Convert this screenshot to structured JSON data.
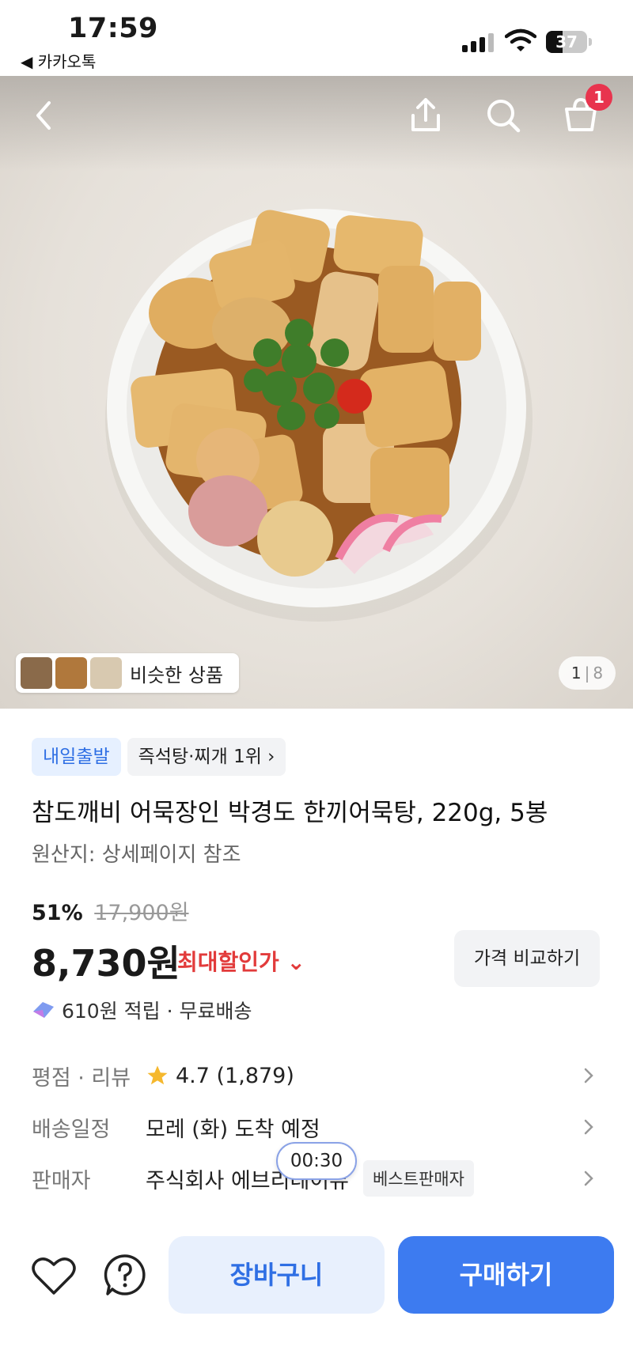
{
  "status_bar": {
    "time": "17:59",
    "back_app": "◀ 카카오톡",
    "battery": "37"
  },
  "header": {
    "cart_badge": "1",
    "icons": [
      "back-arrow-icon",
      "share-icon",
      "search-icon",
      "cart-icon"
    ]
  },
  "gallery": {
    "similar_label": "비슷한 상품",
    "page_current": "1",
    "page_sep": "|",
    "page_total": "8"
  },
  "product": {
    "tags": [
      "내일출발",
      "즉석탕·찌개 1위 ›"
    ],
    "title": "참도깨비 어묵장인 박경도 한끼어묵탕, 220g, 5봉",
    "origin": "원산지: 상세페이지 참조",
    "discount_rate": "51%",
    "original_price": "17,900원",
    "price": "8,730원",
    "price_label": "최대할인가 ⌄",
    "compare_button": "가격 비교하기",
    "points": "610원 적립 · 무료배송"
  },
  "info_rows": {
    "rating_label": "평점 · 리뷰",
    "rating_value": "4.7 (1,879)",
    "delivery_label": "배송일정",
    "delivery_value": "모레 (화) 도착 예정",
    "seller_label": "판매자",
    "seller_value": "주식회사 에브리데이뷰",
    "seller_badge": "베스트판매자"
  },
  "timer": "00:30",
  "bottom_bar": {
    "cart_button": "장바구니",
    "buy_button": "구매하기"
  },
  "colors": {
    "accent_blue": "#3d7bf0",
    "discount_red": "#e23b3b",
    "badge_red": "#e8344e",
    "star": "#f5b82e"
  }
}
